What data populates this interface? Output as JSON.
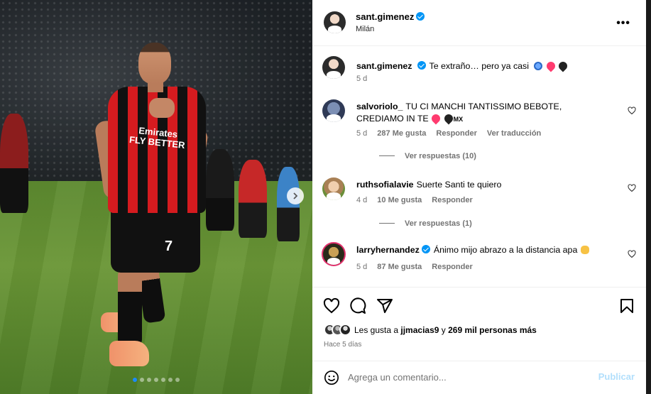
{
  "post": {
    "author": "sant.gimenez",
    "location": "Milán",
    "caption": {
      "username": "sant.gimenez",
      "text": "Te extraño… pero ya casi",
      "time": "5 d"
    },
    "image": {
      "sponsor_text": "Emirates FLY BETTER",
      "shirt_number": "7",
      "carousel_count": 7,
      "carousel_active_index": 0
    }
  },
  "comments": [
    {
      "username": "salvoriolo_",
      "text": "TU CI MANCHI TANTISSIMO BEBOTE, CREDIAMO IN TE",
      "suffix": "MX",
      "time": "5 d",
      "likes": "287 Me gusta",
      "reply": "Responder",
      "translate": "Ver traducción",
      "view_replies": "Ver respuestas (10)"
    },
    {
      "username": "ruthsofialavie",
      "text": "Suerte Santi te quiero",
      "time": "4 d",
      "likes": "10 Me gusta",
      "reply": "Responder",
      "view_replies": "Ver respuestas (1)"
    },
    {
      "username": "larryhernandez",
      "text": "Ánimo mijo abrazo a la distancia apa",
      "time": "5 d",
      "likes": "87 Me gusta",
      "reply": "Responder"
    }
  ],
  "likes_summary": {
    "prefix": "Les gusta a",
    "first_user": "jjmacias9",
    "middle": "y",
    "others": "269 mil personas más"
  },
  "posted_ago": "Hace 5 días",
  "composer": {
    "placeholder": "Agrega un comentario...",
    "post_label": "Publicar"
  },
  "colors": {
    "verified": "#0095f6",
    "post_button_disabled": "#b2dffc",
    "carousel_active": "#1a8cff"
  }
}
